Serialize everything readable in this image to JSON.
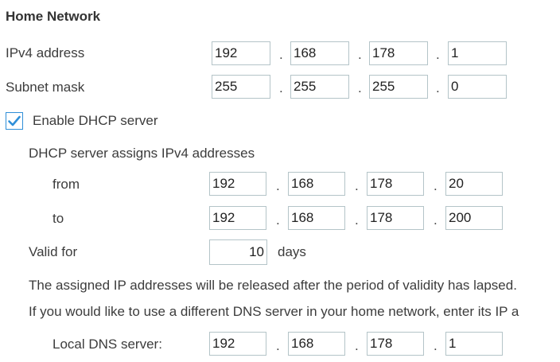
{
  "section_title": "Home Network",
  "ipv4": {
    "label": "IPv4 address",
    "octets": [
      "192",
      "168",
      "178",
      "1"
    ]
  },
  "subnet": {
    "label": "Subnet mask",
    "octets": [
      "255",
      "255",
      "255",
      "0"
    ]
  },
  "dhcp": {
    "checkbox_label": "Enable DHCP server",
    "checked": true,
    "assigns_label": "DHCP server assigns IPv4 addresses",
    "from_label": "from",
    "from_octets": [
      "192",
      "168",
      "178",
      "20"
    ],
    "to_label": "to",
    "to_octets": [
      "192",
      "168",
      "178",
      "200"
    ],
    "valid_label": "Valid for",
    "valid_value": "10",
    "valid_unit": "days"
  },
  "notes": {
    "release": "The assigned IP addresses will be released after the period of validity has lapsed.",
    "dns_hint": "If you would like to use a different DNS server in your home network, enter its IP a"
  },
  "dns": {
    "label": "Local DNS server:",
    "octets": [
      "192",
      "168",
      "178",
      "1"
    ]
  },
  "separator": ".",
  "colors": {
    "checkbox_accent": "#2f8fd8",
    "input_border": "#b4c4c8"
  }
}
